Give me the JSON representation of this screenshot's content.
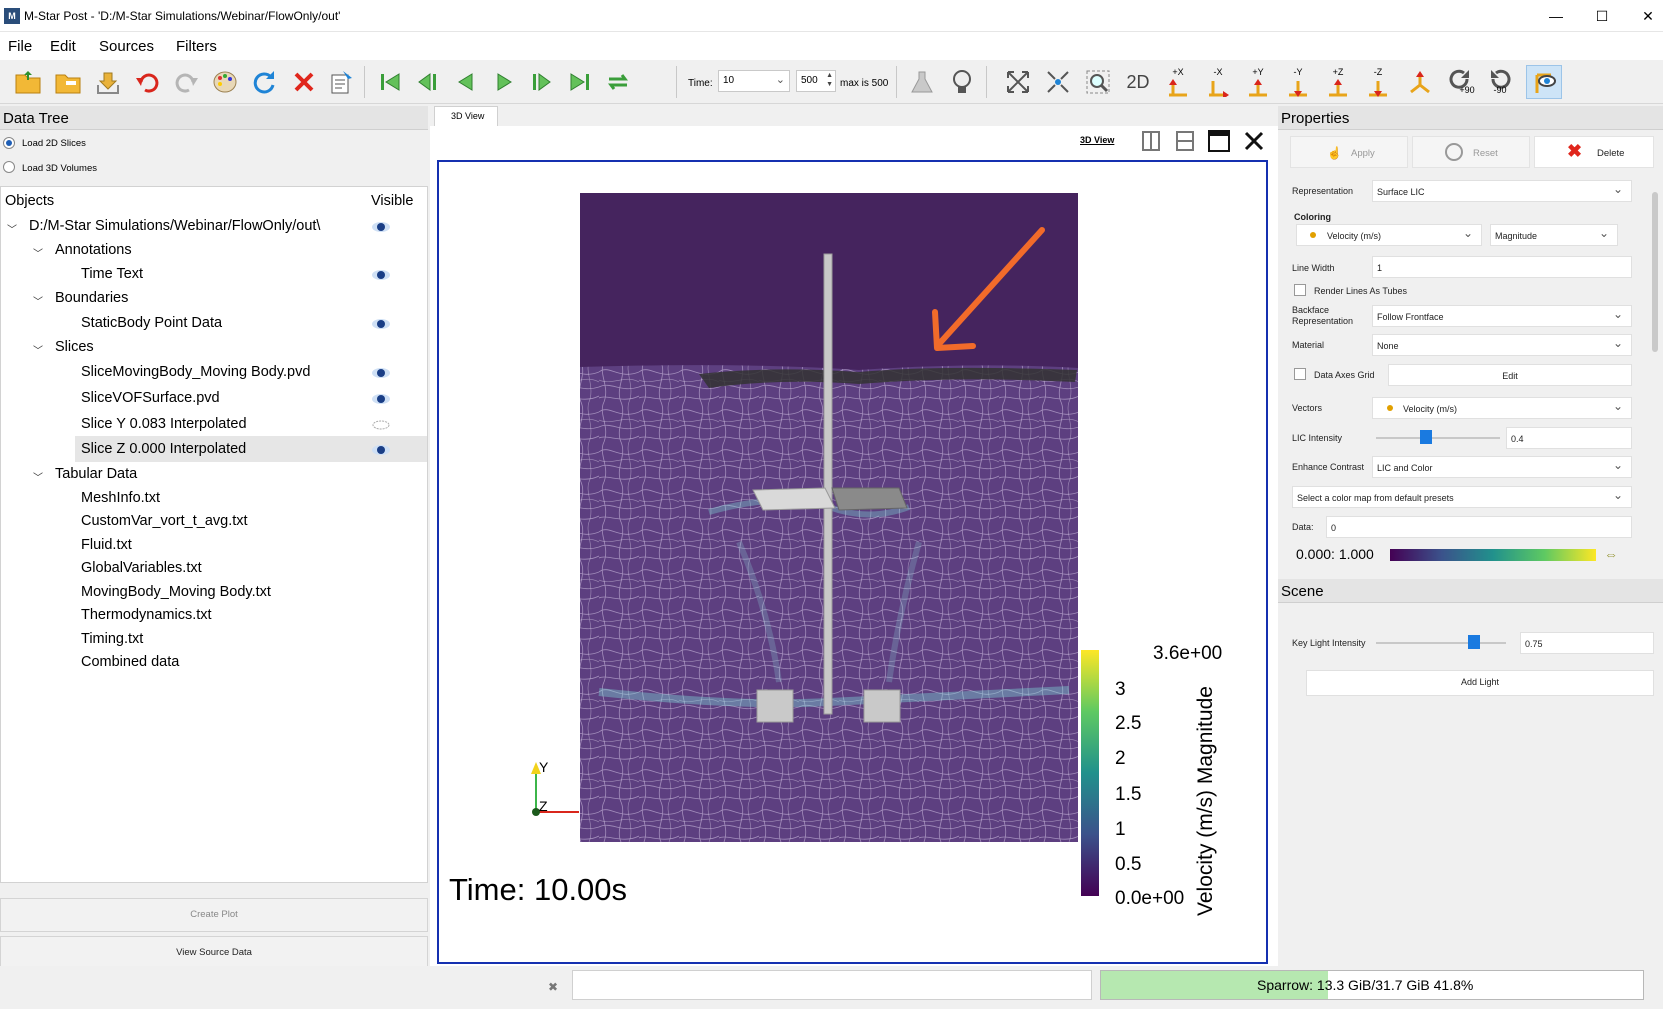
{
  "window": {
    "title": "M-Star Post - 'D:/M-Star Simulations/Webinar/FlowOnly/out'",
    "app_icon": "M",
    "minimize": "—",
    "maximize": "☐",
    "close": "✕"
  },
  "menu": [
    "File",
    "Edit",
    "Sources",
    "Filters"
  ],
  "toolbar": {
    "time_label": "Time:",
    "time_value": "10",
    "step_value": "500",
    "max_label": "max is 500",
    "btn_2d": "2D",
    "axes": [
      "+X",
      "-X",
      "+Y",
      "-Y",
      "+Z",
      "-Z"
    ],
    "rot_plus": "+90",
    "rot_minus": "-90"
  },
  "data_tree": {
    "header": "Data Tree",
    "load_2d": "Load 2D Slices",
    "load_3d": "Load 3D Volumes",
    "col_objects": "Objects",
    "col_visible": "Visible",
    "root": "D:/M-Star Simulations/Webinar/FlowOnly/out\\",
    "groups": {
      "annotations": "Annotations",
      "boundaries": "Boundaries",
      "slices": "Slices",
      "tabular": "Tabular Data"
    },
    "items": {
      "time_text": "Time Text",
      "staticbody": "StaticBody Point Data",
      "slice_moving": "SliceMovingBody_Moving Body.pvd",
      "slice_vof": "SliceVOFSurface.pvd",
      "slice_y": "Slice Y 0.083 Interpolated",
      "slice_z": "Slice Z 0.000 Interpolated",
      "meshinfo": "MeshInfo.txt",
      "customvar": "CustomVar_vort_t_avg.txt",
      "fluid": "Fluid.txt",
      "globalvars": "GlobalVariables.txt",
      "movingbody": "MovingBody_Moving Body.txt",
      "thermo": "Thermodynamics.txt",
      "timing": "Timing.txt",
      "combined": "Combined data"
    },
    "create_plot": "Create Plot",
    "view_source": "View Source Data"
  },
  "view": {
    "tab_label": "3D View",
    "view_link": "3D View",
    "time_text": "Time: 10.00s",
    "axis_y": "Y",
    "axis_z": "Z",
    "colorbar_title": "Velocity (m/s) Magnitude",
    "colorbar_ticks": [
      "3.6e+00",
      "3",
      "2.5",
      "2",
      "1.5",
      "1",
      "0.5",
      "0.0e+00"
    ]
  },
  "properties": {
    "header": "Properties",
    "apply": "Apply",
    "reset": "Reset",
    "delete": "Delete",
    "representation_label": "Representation",
    "representation_value": "Surface LIC",
    "coloring_label": "Coloring",
    "coloring_array": "Velocity (m/s)",
    "coloring_component": "Magnitude",
    "line_width_label": "Line Width",
    "line_width_value": "1",
    "render_tubes": "Render Lines As Tubes",
    "backface_label_1": "Backface",
    "backface_label_2": "Representation",
    "backface_value": "Follow Frontface",
    "material_label": "Material",
    "material_value": "None",
    "axes_grid": "Data Axes Grid",
    "edit": "Edit",
    "vectors_label": "Vectors",
    "vectors_value": "Velocity (m/s)",
    "lic_label": "LIC Intensity",
    "lic_value": "0.4",
    "lic_level": 0.4,
    "enhance_label": "Enhance Contrast",
    "enhance_value": "LIC and Color",
    "colormap_value": "Select a color map from default presets",
    "data_label": "Data:",
    "data_value": "0",
    "range_text": "0.000: 1.000"
  },
  "scene": {
    "header": "Scene",
    "key_light_label": "Key Light Intensity",
    "key_light_value": "0.75",
    "key_light_level": 0.75,
    "add_light": "Add Light"
  },
  "statusbar": {
    "memory": "Sparrow: 13.3 GiB/31.7 GiB 41.8%",
    "memory_fraction": 0.418
  },
  "colors": {
    "accent": "#1530b0",
    "brand": "#2a4d7a",
    "arrow": "#f26b2a",
    "fluid": "#5b3b7e",
    "air": "#45245e"
  }
}
